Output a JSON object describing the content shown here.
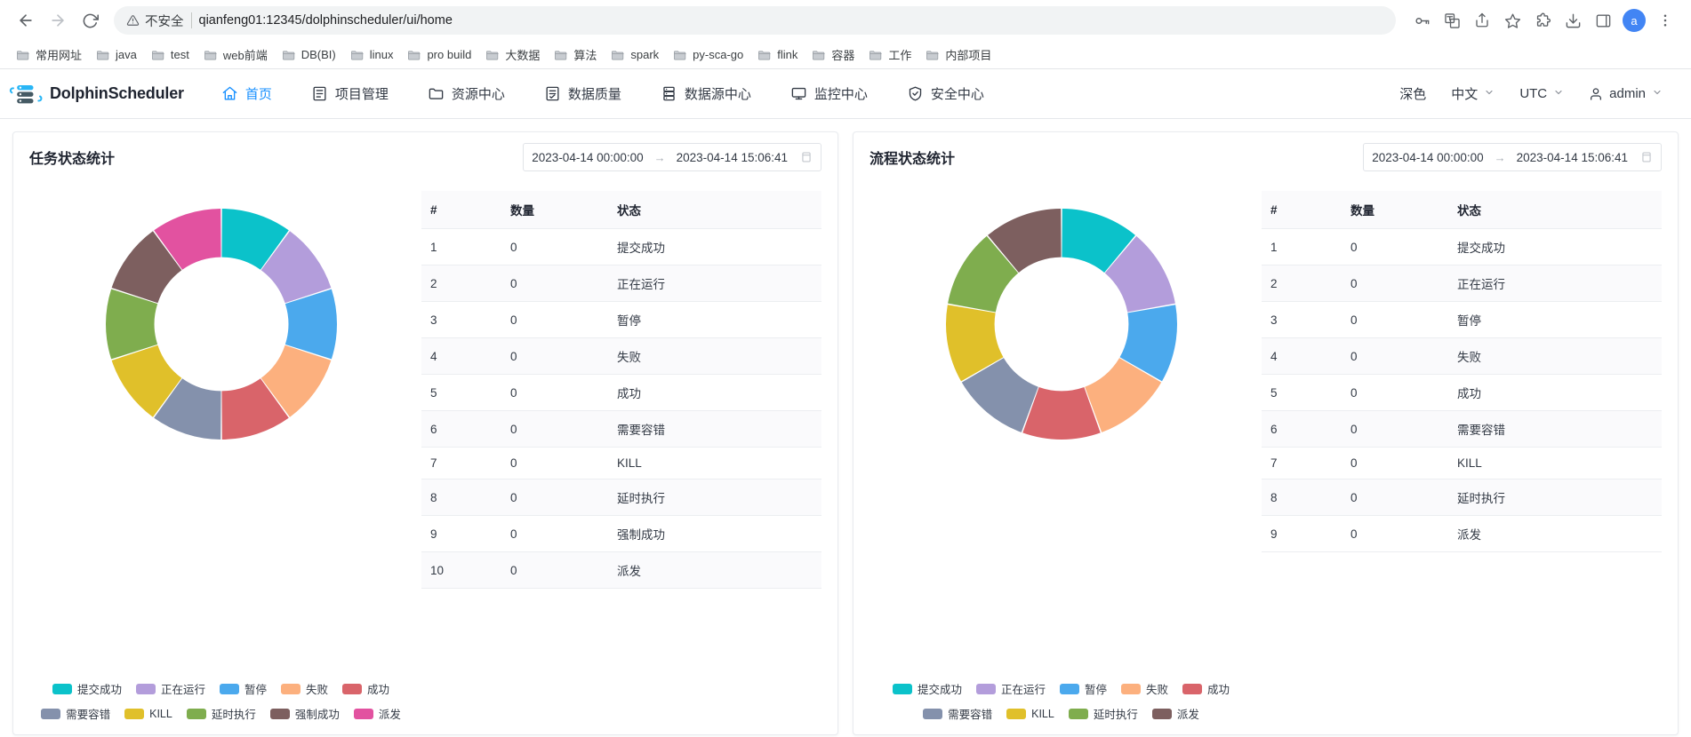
{
  "browser": {
    "back_icon": "back-arrow-icon",
    "forward_icon": "forward-arrow-icon",
    "reload_icon": "reload-icon",
    "security_label": "不安全",
    "url": "qianfeng01:12345/dolphinscheduler/ui/home",
    "profile_initial": "a",
    "bookmarks": [
      {
        "label": "常用网址"
      },
      {
        "label": "java"
      },
      {
        "label": "test"
      },
      {
        "label": "web前端"
      },
      {
        "label": "DB(BI)"
      },
      {
        "label": "linux"
      },
      {
        "label": "pro build"
      },
      {
        "label": "大数据"
      },
      {
        "label": "算法"
      },
      {
        "label": "spark"
      },
      {
        "label": "py-sca-go"
      },
      {
        "label": "flink"
      },
      {
        "label": "容器"
      },
      {
        "label": "工作"
      },
      {
        "label": "内部项目"
      }
    ]
  },
  "app": {
    "brand": "DolphinScheduler",
    "nav": [
      {
        "label": "首页",
        "icon": "home-icon",
        "active": true
      },
      {
        "label": "项目管理",
        "icon": "project-icon",
        "active": false
      },
      {
        "label": "资源中心",
        "icon": "folder-icon",
        "active": false
      },
      {
        "label": "数据质量",
        "icon": "quality-icon",
        "active": false
      },
      {
        "label": "数据源中心",
        "icon": "datasource-icon",
        "active": false
      },
      {
        "label": "监控中心",
        "icon": "monitor-icon",
        "active": false
      },
      {
        "label": "安全中心",
        "icon": "shield-icon",
        "active": false
      }
    ],
    "header_right": {
      "theme_label": "深色",
      "language_label": "中文",
      "timezone_label": "UTC",
      "user_label": "admin"
    }
  },
  "cards": [
    {
      "title": "任务状态统计",
      "date_start": "2023-04-14 00:00:00",
      "date_arrow": "→",
      "date_end": "2023-04-14 15:06:41",
      "table": {
        "columns": [
          "#",
          "数量",
          "状态"
        ],
        "rows": [
          [
            "1",
            "0",
            "提交成功"
          ],
          [
            "2",
            "0",
            "正在运行"
          ],
          [
            "3",
            "0",
            "暂停"
          ],
          [
            "4",
            "0",
            "失败"
          ],
          [
            "5",
            "0",
            "成功"
          ],
          [
            "6",
            "0",
            "需要容错"
          ],
          [
            "7",
            "0",
            "KILL"
          ],
          [
            "8",
            "0",
            "延时执行"
          ],
          [
            "9",
            "0",
            "强制成功"
          ],
          [
            "10",
            "0",
            "派发"
          ]
        ]
      },
      "chart_data": {
        "type": "pie",
        "title": "任务状态统计",
        "donut": true,
        "inner_radius_ratio": 0.58,
        "labels": [
          "提交成功",
          "正在运行",
          "暂停",
          "失败",
          "成功",
          "需要容错",
          "KILL",
          "延时执行",
          "强制成功",
          "派发"
        ],
        "values": [
          0,
          0,
          0,
          0,
          0,
          0,
          0,
          0,
          0,
          0
        ],
        "display_slices": [
          1,
          1,
          1,
          1,
          1,
          1,
          1,
          1,
          1,
          1
        ],
        "colors": [
          "#0bc2ca",
          "#b39ddb",
          "#4ba9ed",
          "#fcb07e",
          "#d9646a",
          "#8491ac",
          "#e0c02a",
          "#7fad4e",
          "#7d5f5f",
          "#e252a0"
        ],
        "legend_position": "bottom"
      }
    },
    {
      "title": "流程状态统计",
      "date_start": "2023-04-14 00:00:00",
      "date_arrow": "→",
      "date_end": "2023-04-14 15:06:41",
      "table": {
        "columns": [
          "#",
          "数量",
          "状态"
        ],
        "rows": [
          [
            "1",
            "0",
            "提交成功"
          ],
          [
            "2",
            "0",
            "正在运行"
          ],
          [
            "3",
            "0",
            "暂停"
          ],
          [
            "4",
            "0",
            "失败"
          ],
          [
            "5",
            "0",
            "成功"
          ],
          [
            "6",
            "0",
            "需要容错"
          ],
          [
            "7",
            "0",
            "KILL"
          ],
          [
            "8",
            "0",
            "延时执行"
          ],
          [
            "9",
            "0",
            "派发"
          ]
        ]
      },
      "chart_data": {
        "type": "pie",
        "title": "流程状态统计",
        "donut": true,
        "inner_radius_ratio": 0.58,
        "labels": [
          "提交成功",
          "正在运行",
          "暂停",
          "失败",
          "成功",
          "需要容错",
          "KILL",
          "延时执行",
          "派发"
        ],
        "values": [
          0,
          0,
          0,
          0,
          0,
          0,
          0,
          0,
          0
        ],
        "display_slices": [
          1,
          1,
          1,
          1,
          1,
          1,
          1,
          1,
          1
        ],
        "colors": [
          "#0bc2ca",
          "#b39ddb",
          "#4ba9ed",
          "#fcb07e",
          "#d9646a",
          "#8491ac",
          "#e0c02a",
          "#7fad4e",
          "#7d5f5f"
        ],
        "legend_position": "bottom"
      }
    }
  ],
  "legends": [
    {
      "rows": [
        [
          {
            "label": "提交成功",
            "color": "#0bc2ca"
          },
          {
            "label": "正在运行",
            "color": "#b39ddb"
          },
          {
            "label": "暂停",
            "color": "#4ba9ed"
          },
          {
            "label": "失败",
            "color": "#fcb07e"
          },
          {
            "label": "成功",
            "color": "#d9646a"
          }
        ],
        [
          {
            "label": "需要容错",
            "color": "#8491ac"
          },
          {
            "label": "KILL",
            "color": "#e0c02a"
          },
          {
            "label": "延时执行",
            "color": "#7fad4e"
          },
          {
            "label": "强制成功",
            "color": "#7d5f5f"
          },
          {
            "label": "派发",
            "color": "#e252a0"
          }
        ]
      ]
    },
    {
      "rows": [
        [
          {
            "label": "提交成功",
            "color": "#0bc2ca"
          },
          {
            "label": "正在运行",
            "color": "#b39ddb"
          },
          {
            "label": "暂停",
            "color": "#4ba9ed"
          },
          {
            "label": "失败",
            "color": "#fcb07e"
          },
          {
            "label": "成功",
            "color": "#d9646a"
          }
        ],
        [
          {
            "label": "需要容错",
            "color": "#8491ac"
          },
          {
            "label": "KILL",
            "color": "#e0c02a"
          },
          {
            "label": "延时执行",
            "color": "#7fad4e"
          },
          {
            "label": "派发",
            "color": "#7d5f5f"
          }
        ]
      ]
    }
  ],
  "theme": {
    "accent": "#1890ff",
    "text": "#333a45",
    "border": "#e9ebef"
  }
}
